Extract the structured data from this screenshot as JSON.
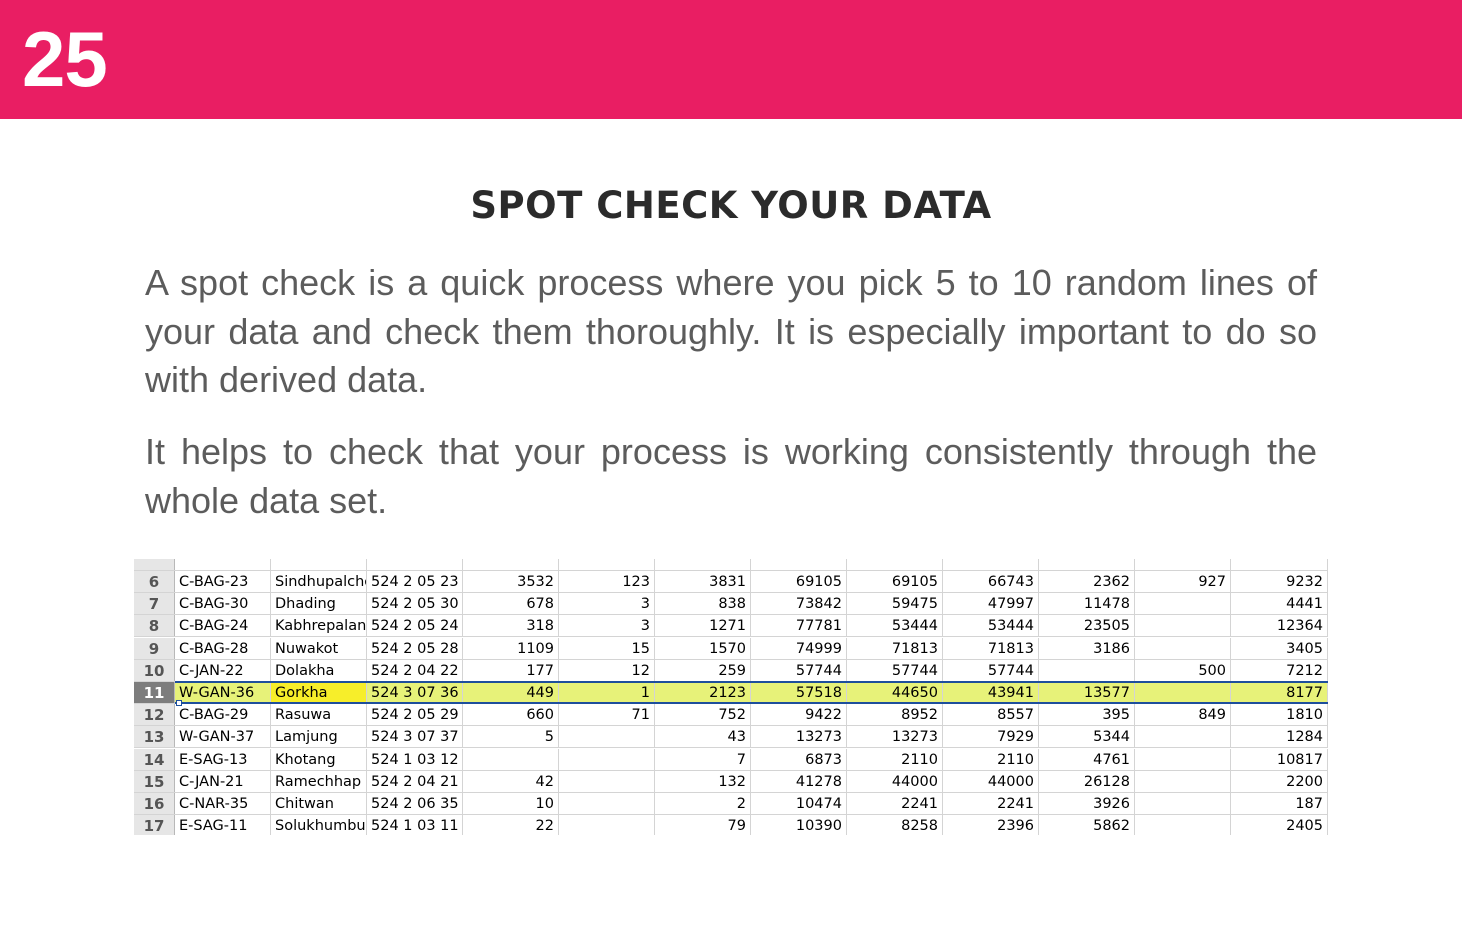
{
  "page_number": "25",
  "title": "SPOT CHECK YOUR DATA",
  "paragraphs": [
    "A spot check is a quick process where you pick 5 to 10 random lines of your data and check them thoroughly. It is especially important to do so with derived data.",
    "It helps to check that your process is working consistently through the whole data set."
  ],
  "colors": {
    "banner": "#e91e63",
    "row_highlight": "#e7f279",
    "cell_highlight": "#f7ee2a",
    "selection_border": "#1e4f9c"
  },
  "spreadsheet": {
    "selected_row": "11",
    "rows": [
      {
        "n": "6",
        "code": "C-BAG-23",
        "district": "Sindhupalchok",
        "id": "524 2 05 23",
        "v": [
          "3532",
          "123",
          "3831",
          "69105",
          "69105",
          "66743",
          "2362",
          "927",
          "9232"
        ]
      },
      {
        "n": "7",
        "code": "C-BAG-30",
        "district": "Dhading",
        "id": "524 2 05 30",
        "v": [
          "678",
          "3",
          "838",
          "73842",
          "59475",
          "47997",
          "11478",
          "",
          "4441"
        ]
      },
      {
        "n": "8",
        "code": "C-BAG-24",
        "district": "Kabhrepalanchok",
        "id": "524 2 05 24",
        "v": [
          "318",
          "3",
          "1271",
          "77781",
          "53444",
          "53444",
          "23505",
          "",
          "12364"
        ]
      },
      {
        "n": "9",
        "code": "C-BAG-28",
        "district": "Nuwakot",
        "id": "524 2 05 28",
        "v": [
          "1109",
          "15",
          "1570",
          "74999",
          "71813",
          "71813",
          "3186",
          "",
          "3405"
        ]
      },
      {
        "n": "10",
        "code": "C-JAN-22",
        "district": "Dolakha",
        "id": "524 2 04 22",
        "v": [
          "177",
          "12",
          "259",
          "57744",
          "57744",
          "57744",
          "",
          "500",
          "7212"
        ]
      },
      {
        "n": "11",
        "code": "W-GAN-36",
        "district": "Gorkha",
        "id": "524 3 07 36",
        "v": [
          "449",
          "1",
          "2123",
          "57518",
          "44650",
          "43941",
          "13577",
          "",
          "8177"
        ]
      },
      {
        "n": "12",
        "code": "C-BAG-29",
        "district": "Rasuwa",
        "id": "524 2 05 29",
        "v": [
          "660",
          "71",
          "752",
          "9422",
          "8952",
          "8557",
          "395",
          "849",
          "1810"
        ]
      },
      {
        "n": "13",
        "code": "W-GAN-37",
        "district": "Lamjung",
        "id": "524 3 07 37",
        "v": [
          "5",
          "",
          "43",
          "13273",
          "13273",
          "7929",
          "5344",
          "",
          "1284"
        ]
      },
      {
        "n": "14",
        "code": "E-SAG-13",
        "district": "Khotang",
        "id": "524 1 03 12",
        "v": [
          "",
          "",
          "7",
          "6873",
          "2110",
          "2110",
          "4761",
          "",
          "10817"
        ]
      },
      {
        "n": "15",
        "code": "C-JAN-21",
        "district": "Ramechhap",
        "id": "524 2 04 21",
        "v": [
          "42",
          "",
          "132",
          "41278",
          "44000",
          "44000",
          "26128",
          "",
          "2200"
        ]
      },
      {
        "n": "16",
        "code": "C-NAR-35",
        "district": "Chitwan",
        "id": "524 2 06 35",
        "v": [
          "10",
          "",
          "2",
          "10474",
          "2241",
          "2241",
          "3926",
          "",
          "187"
        ]
      },
      {
        "n": "17",
        "code": "E-SAG-11",
        "district": "Solukhumbu",
        "id": "524 1 03 11",
        "v": [
          "22",
          "",
          "79",
          "10390",
          "8258",
          "2396",
          "5862",
          "",
          "2405"
        ]
      }
    ]
  }
}
